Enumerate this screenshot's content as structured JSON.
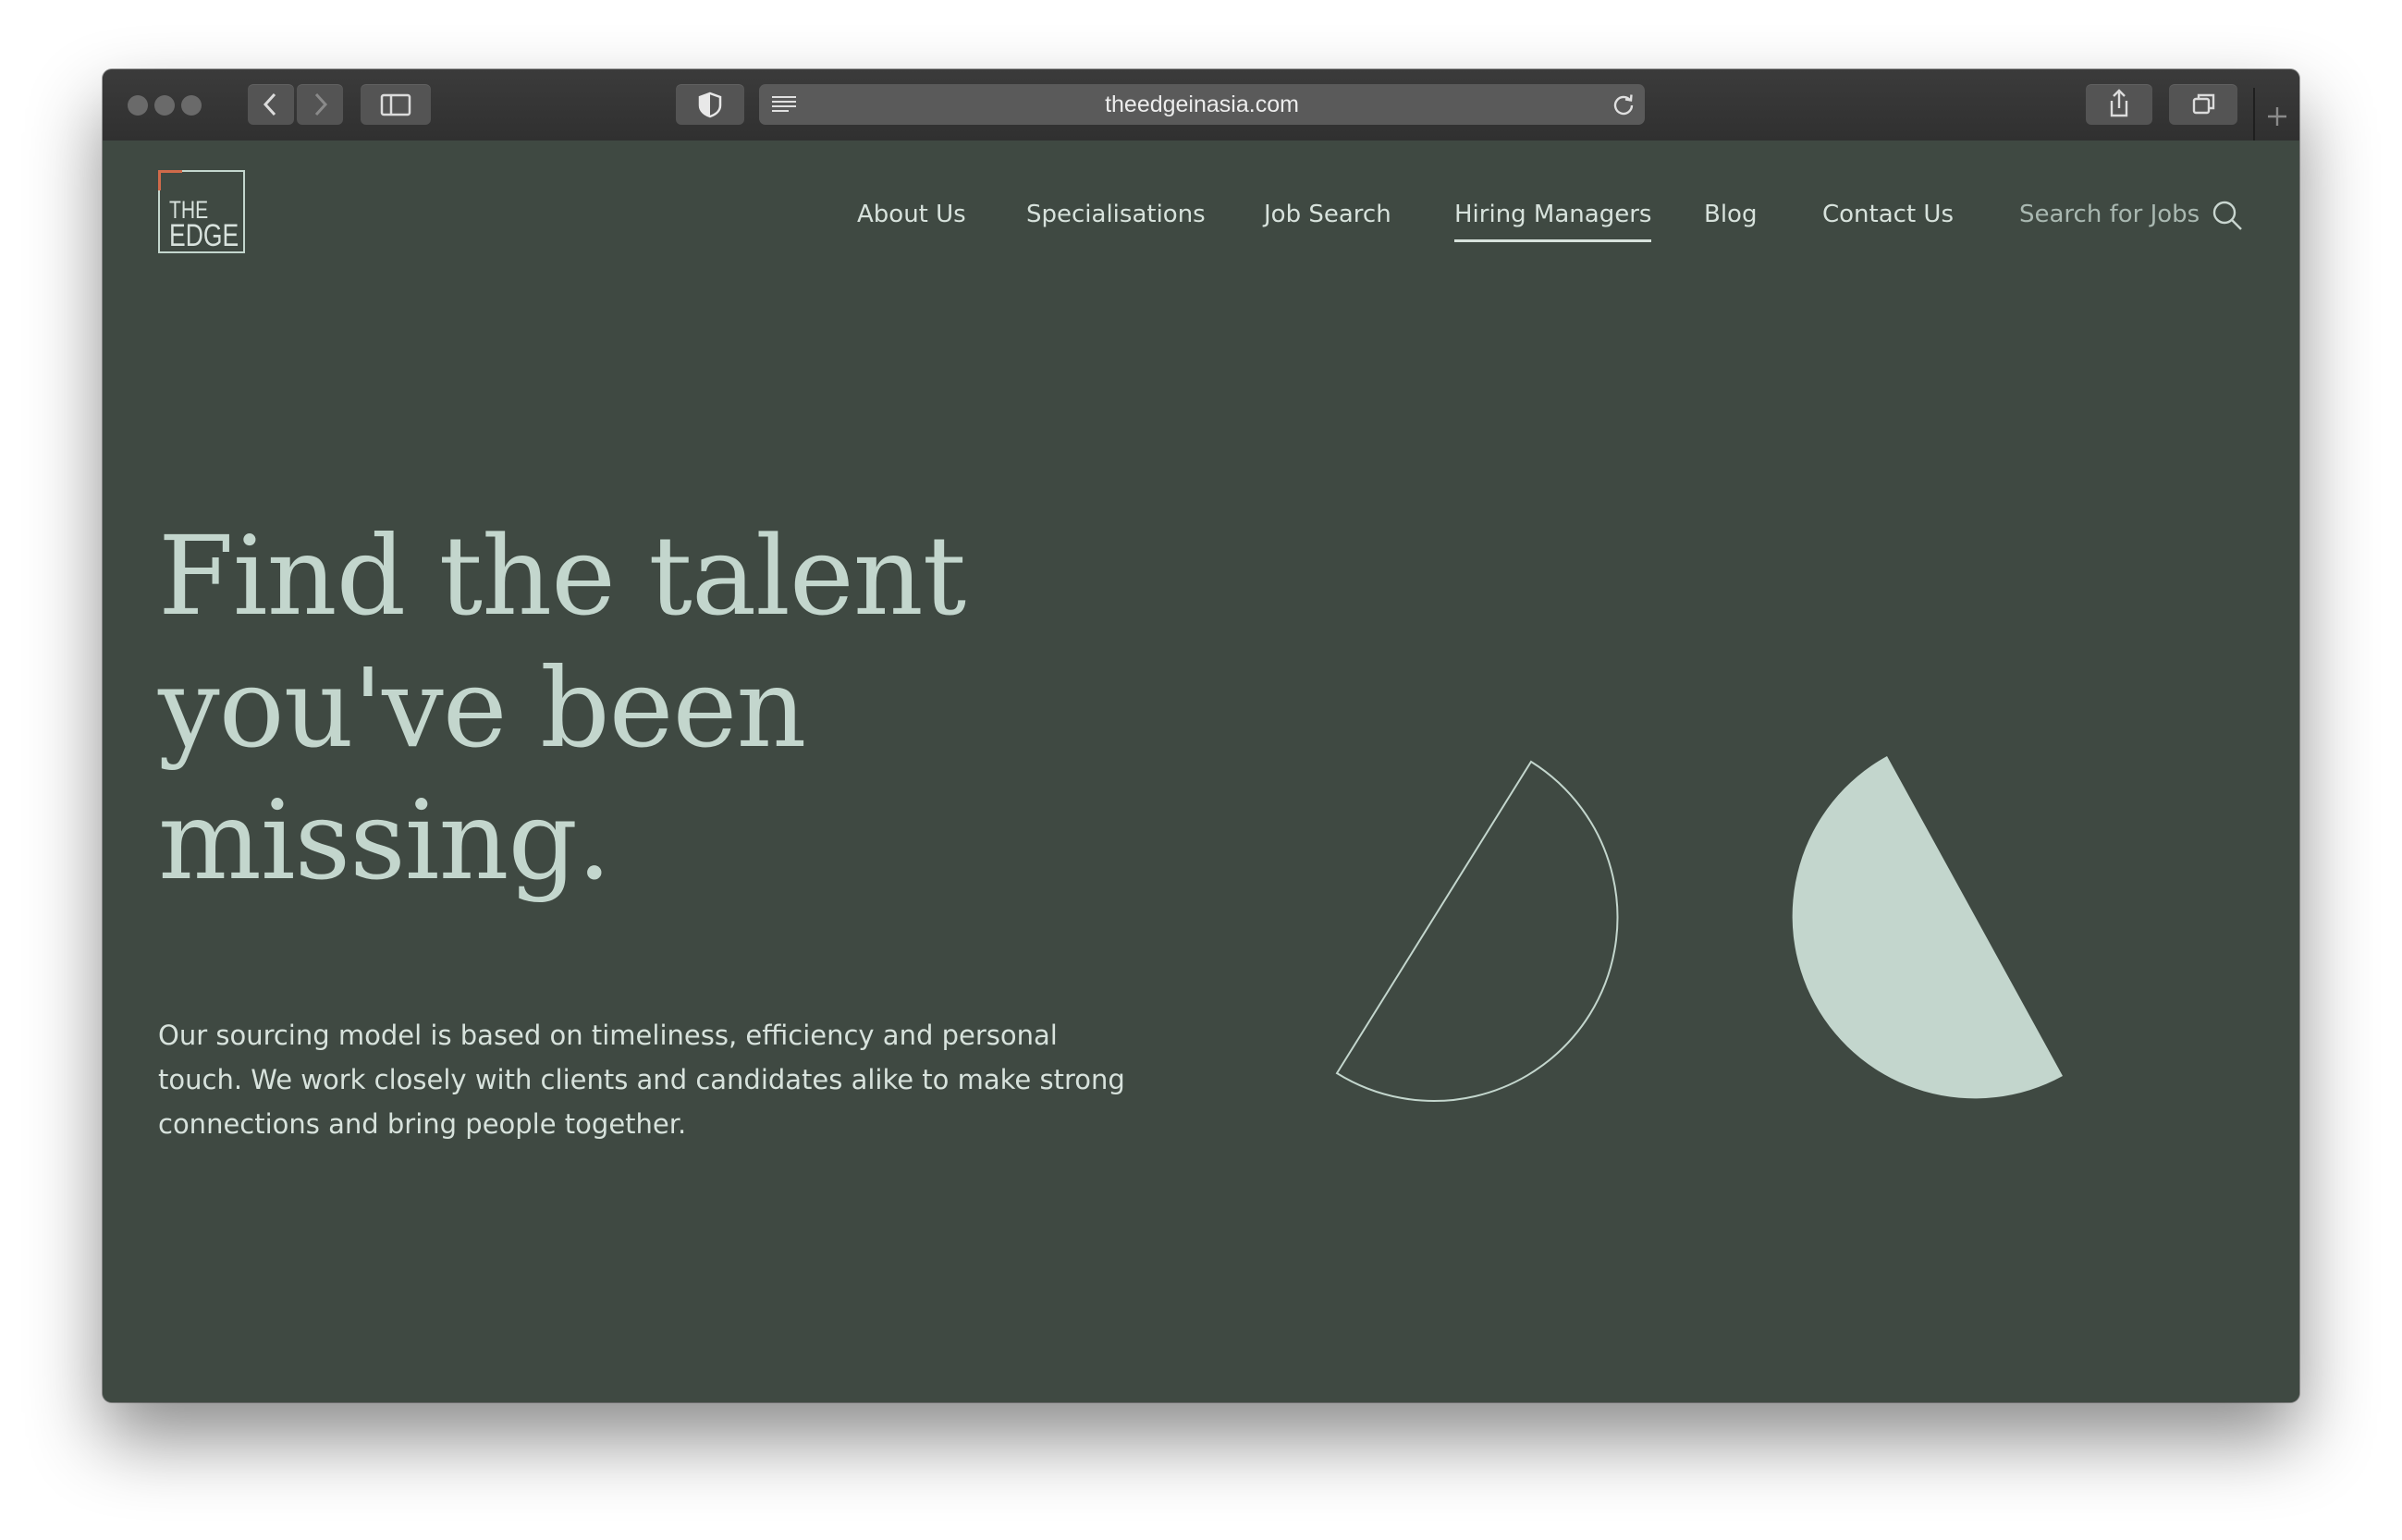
{
  "browser": {
    "url": "theedgeinasia.com"
  },
  "logo": {
    "line1": "THE",
    "line2": "EDGE"
  },
  "nav": {
    "items": [
      {
        "label": "About Us"
      },
      {
        "label": "Specialisations"
      },
      {
        "label": "Job Search"
      },
      {
        "label": "Hiring Managers"
      },
      {
        "label": "Blog"
      },
      {
        "label": "Contact Us"
      }
    ],
    "active": "Hiring Managers",
    "search_placeholder": "Search for Jobs"
  },
  "hero": {
    "lines": [
      "Find the talent",
      "you've been",
      "missing."
    ],
    "body_lines": [
      "Our sourcing model is based on timeliness, efficiency and personal",
      "touch. We work closely with clients and candidates alike to make strong",
      "connections and bring people together."
    ]
  },
  "colors": {
    "page_background": "#3f4942",
    "accent": "#c3d6cd",
    "text": "#d7e2dc",
    "logo_corner": "#d06a4a"
  }
}
